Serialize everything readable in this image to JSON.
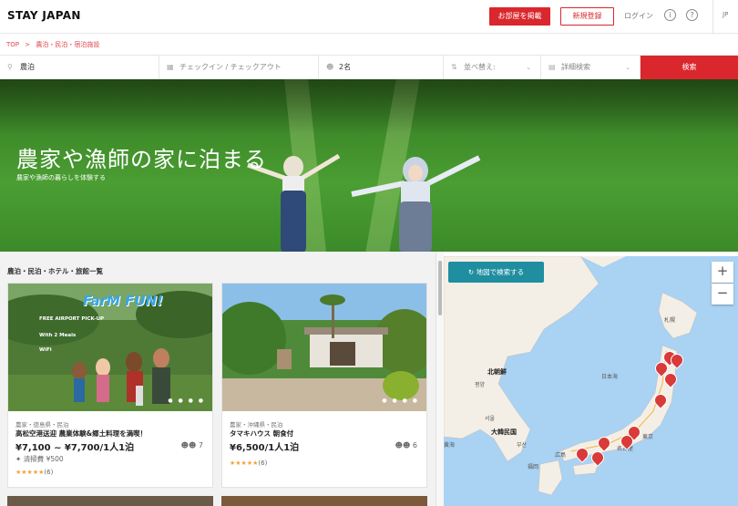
{
  "header": {
    "logo": "STAY JAPAN",
    "post_button": "お部屋を掲載",
    "signup_button": "新規登録",
    "login": "ログイン",
    "info_icon": "i",
    "help_icon": "?",
    "lang": "JP"
  },
  "breadcrumb": {
    "top": "TOP",
    "sep": ">",
    "current": "農泊・民泊・宿泊施設"
  },
  "search": {
    "keyword": "農泊",
    "dates": "チェックイン / チェックアウト",
    "guests": "2名",
    "sort": "並べ替え:",
    "filter": "詳細検索",
    "button": "検索"
  },
  "hero": {
    "title": "農家や漁師の家に泊まる",
    "subtitle": "農家や漁師の暮らしを体験する"
  },
  "list": {
    "title": "農泊・民泊・ホテル・旅館一覧",
    "cards": [
      {
        "meta": "農家・徳島県・民泊",
        "name": "高松空港送迎 農業体験&郷土料理を満喫！",
        "price": "¥7,100 ~ ¥7,700/1人1泊",
        "guests": "7",
        "fee": "清掃費 ¥500",
        "stars": "★★★★★",
        "reviews": "(6)",
        "overlay_title": "FarM FUN!",
        "overlay_1": "FREE AIRPORT PICK-UP",
        "overlay_2": "With 2 Meals",
        "overlay_3": "WiFi"
      },
      {
        "meta": "農家・沖縄県・民泊",
        "name": "タマキハウス 朝食付",
        "price": "¥6,500/1人1泊",
        "guests": "6",
        "stars": "★★★★★",
        "reviews": "(6)"
      }
    ]
  },
  "map": {
    "search_button": "地図で検索する",
    "zoom_in": "+",
    "zoom_out": "−",
    "labels": {
      "sapporo": "札幌",
      "japan": "日本",
      "sea_of_japan": "日本海",
      "north_korea": "北朝鮮",
      "pyongyang": "평양",
      "seoul": "서울",
      "south_korea": "大韓民国",
      "busan": "부산",
      "tokyo": "東京",
      "nagoya": "名古屋",
      "osaka": "大阪",
      "hiroshima": "広島",
      "fukuoka": "福岡",
      "sendai": "仙台",
      "yellow_sea": "黄海",
      "dalian": "大連"
    }
  },
  "colors": {
    "accent": "#d9272d",
    "map_button": "#1f8ea0",
    "water": "#a9d2f3",
    "land": "#f4efe6",
    "star": "#f2a23a"
  }
}
